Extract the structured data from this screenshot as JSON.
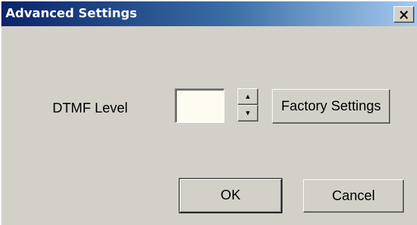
{
  "window": {
    "title": "Advanced Settings",
    "close_icon": "close-icon",
    "close_glyph": "×"
  },
  "form": {
    "dtmf_label": "DTMF Level",
    "dtmf_value": "",
    "spin_up_icon": "arrow-up-icon",
    "spin_down_icon": "arrow-down-icon",
    "spin_up_glyph": "▲",
    "spin_down_glyph": "▼",
    "factory_settings_label": "Factory Settings"
  },
  "buttons": {
    "ok_label": "OK",
    "cancel_label": "Cancel"
  },
  "colors": {
    "face": "#d4d0c8",
    "title_start": "#0a246a",
    "title_end": "#a6caf0",
    "input_bg": "#fffbf0"
  }
}
